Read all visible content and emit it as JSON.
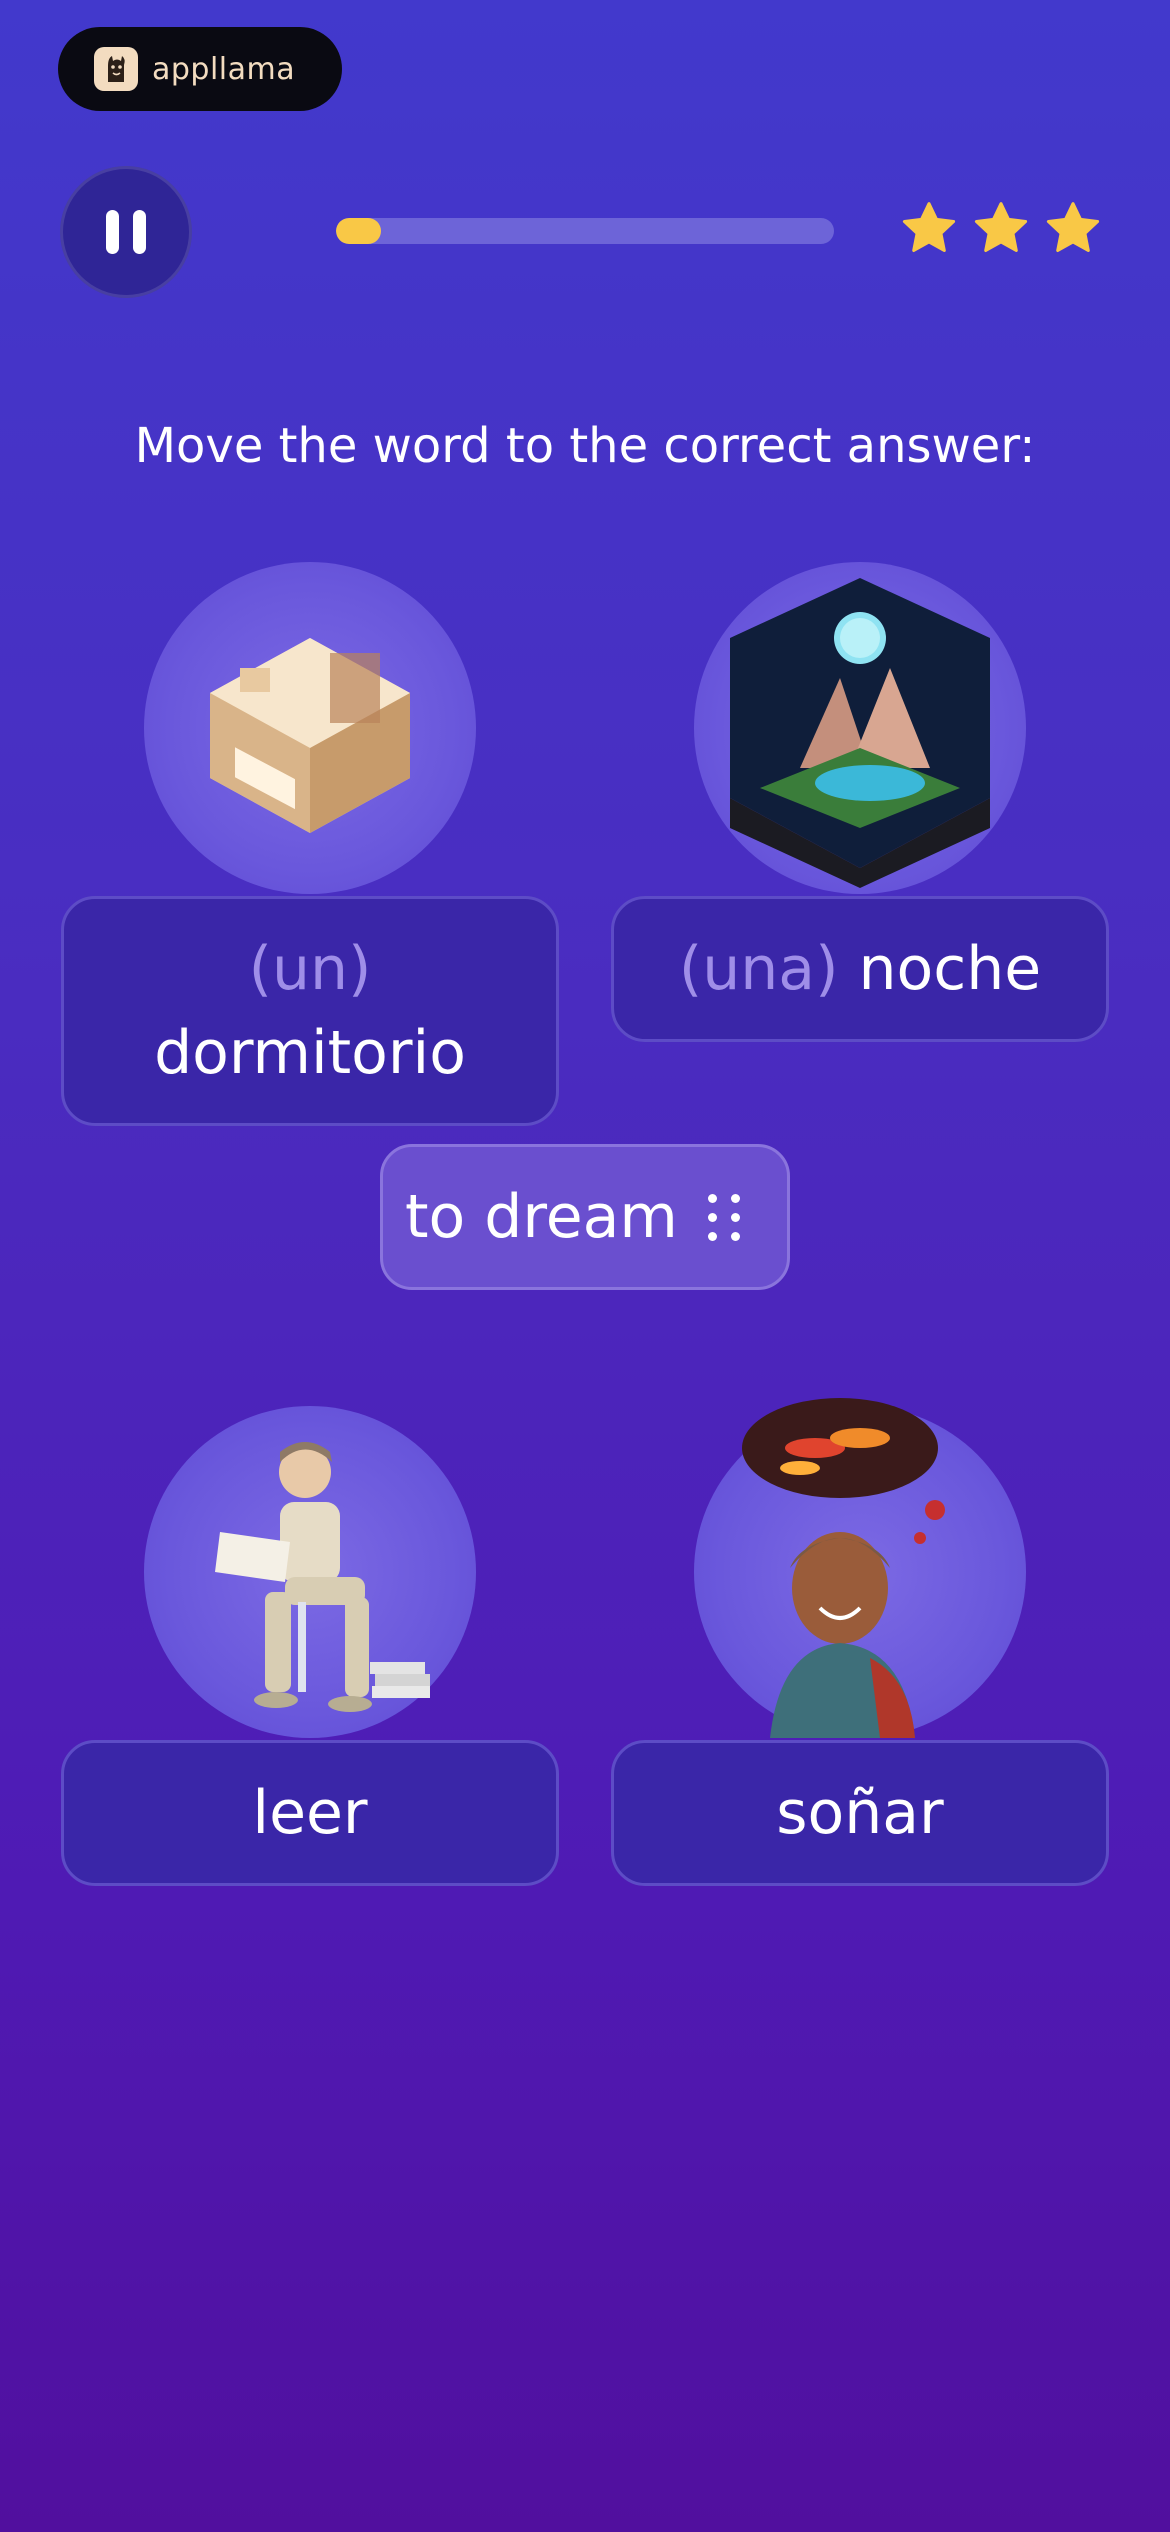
{
  "brand": {
    "name": "appllama",
    "logo_icon": "llama-icon"
  },
  "header": {
    "pause_icon": "pause-icon",
    "progress_fraction": 0.09,
    "progress_color": "#f9c846",
    "stars": {
      "count": 3,
      "color": "#f9c846"
    }
  },
  "instruction": "Move the word to the correct answer:",
  "drag_word": {
    "label": "to dream",
    "handle_icon": "drag-handle-icon"
  },
  "answers": [
    {
      "picture": "bedroom-image",
      "article": "(un)",
      "word": "dormitorio"
    },
    {
      "picture": "night-landscape-image",
      "article": "(una)",
      "word": "noche"
    },
    {
      "picture": "boy-reading-image",
      "article": "",
      "word": "leer"
    },
    {
      "picture": "woman-dreaming-image",
      "article": "",
      "word": "soñar"
    }
  ]
}
